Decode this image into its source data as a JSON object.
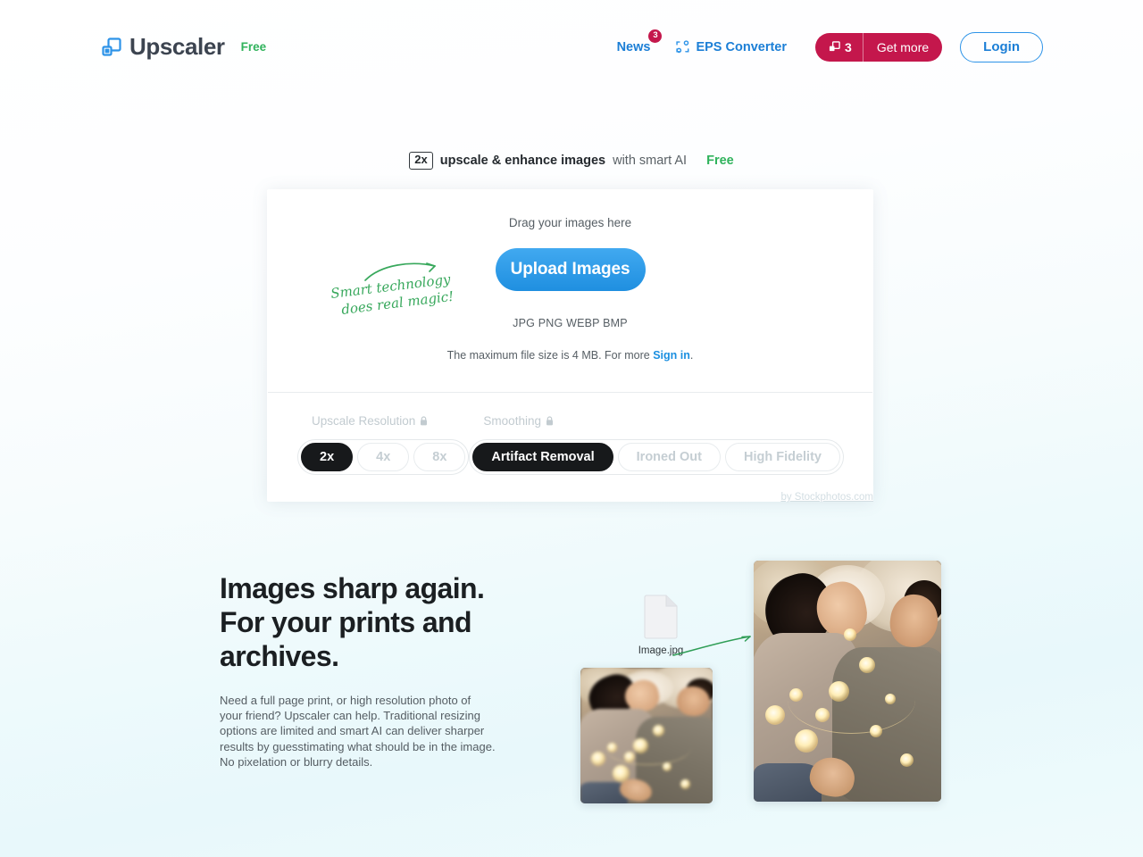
{
  "header": {
    "brand_name": "Upscaler",
    "brand_badge": "Free",
    "logo_icon": "overlapping-squares-icon",
    "nav": {
      "news_label": "News",
      "news_badge": "3",
      "eps_label": "EPS Converter",
      "eps_icon": "crop-frame-icon",
      "credits_icon": "upscale-icon",
      "credits_count": "3",
      "get_more_label": "Get more",
      "login_label": "Login"
    }
  },
  "tagline": {
    "badge": "2x",
    "bold_text": "upscale & enhance images",
    "rest_text": "with smart AI",
    "free_label": "Free"
  },
  "upload_card": {
    "drop_title": "Drag your images here",
    "upload_button": "Upload Images",
    "formats": "JPG PNG WEBP BMP",
    "max_size_text": "The maximum file size is 4 MB. For more ",
    "sign_in_label": "Sign in",
    "max_size_suffix": ".",
    "scribble_text": "Smart technology does real magic!",
    "options": {
      "resolution": {
        "label": "Upscale Resolution",
        "lock_icon": "lock-icon",
        "choices": [
          "2x",
          "4x",
          "8x"
        ],
        "selected": "2x"
      },
      "smoothing": {
        "label": "Smoothing",
        "lock_icon": "lock-icon",
        "choices": [
          "Artifact Removal",
          "Ironed Out",
          "High Fidelity"
        ],
        "selected": "Artifact Removal"
      }
    },
    "byline": "by Stockphotos.com"
  },
  "feature": {
    "heading_line1": "Images sharp again.",
    "heading_line2": "For your prints and",
    "heading_line3": "archives.",
    "body": "Need a full page print, or high resolution photo of your friend? Upscaler can help. Traditional resizing options are limited and smart AI can deliver sharper results by guesstimating what should be in the image. No pixelation or blurry details.",
    "file_name": "Image.jpg",
    "file_icon": "document-icon",
    "arrow_icon": "curved-arrow-icon",
    "before_image_alt": "couple lying down with string lights, low resolution",
    "after_image_alt": "couple lying down with string lights, upscaled"
  },
  "colors": {
    "brand_blue": "#1b7ed6",
    "accent_crimson": "#c4174c",
    "green": "#30b35c",
    "dark": "#17191b",
    "upload_blue": "#2d9aea"
  }
}
